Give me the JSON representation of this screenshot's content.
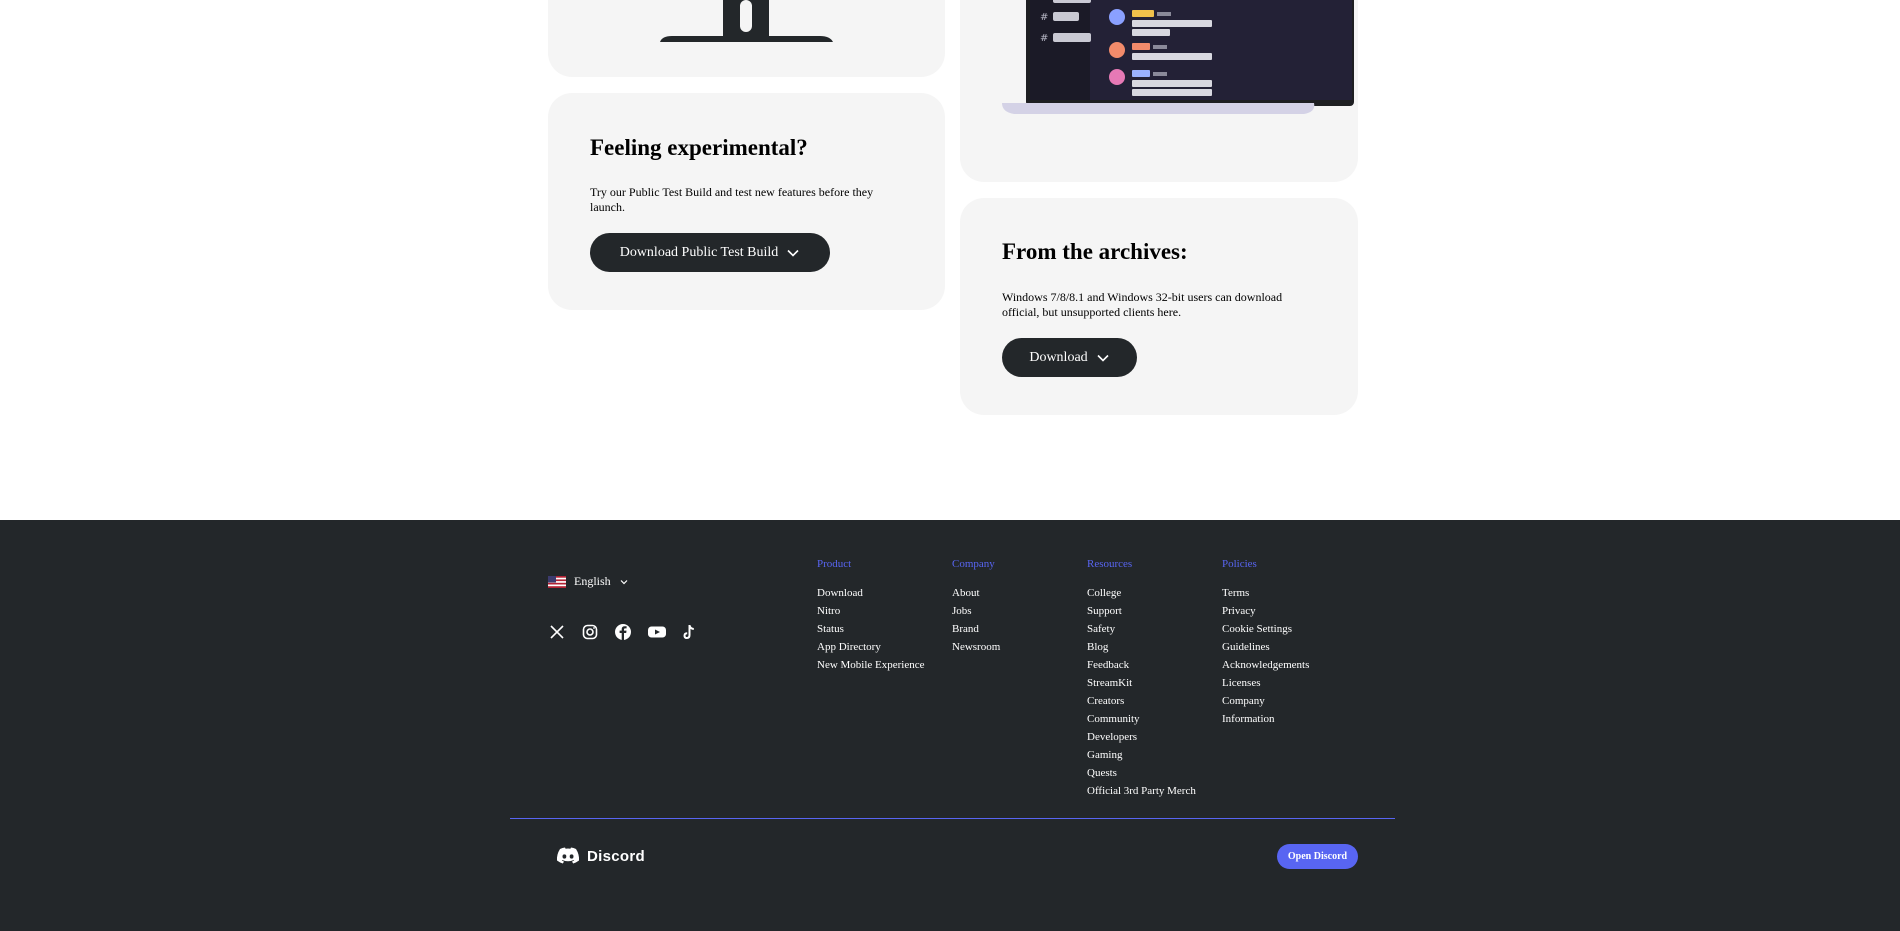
{
  "cards": {
    "experimental": {
      "title": "Feeling experimental?",
      "body": "Try our Public Test Build and test new features before they launch.",
      "button": "Download Public Test Build"
    },
    "archives": {
      "title": "From the archives:",
      "body": "Windows 7/8/8.1 and Windows 32-bit users can download official, but unsupported clients here.",
      "button": "Download"
    }
  },
  "footer": {
    "language": "English",
    "socials": [
      "x-icon",
      "instagram-icon",
      "facebook-icon",
      "youtube-icon",
      "tiktok-icon"
    ],
    "columns": [
      {
        "heading": "Product",
        "links": [
          "Download",
          "Nitro",
          "Status",
          "App Directory",
          "New Mobile Experience"
        ]
      },
      {
        "heading": "Company",
        "links": [
          "About",
          "Jobs",
          "Brand",
          "Newsroom"
        ]
      },
      {
        "heading": "Resources",
        "links": [
          "College",
          "Support",
          "Safety",
          "Blog",
          "Feedback",
          "StreamKit",
          "Creators",
          "Community",
          "Developers",
          "Gaming",
          "Quests",
          "Official 3rd Party Merch"
        ]
      },
      {
        "heading": "Policies",
        "links": [
          "Terms",
          "Privacy",
          "Cookie Settings",
          "Guidelines",
          "Acknowledgements",
          "Licenses",
          "Company",
          "Information"
        ]
      }
    ],
    "brand": "Discord",
    "open_button": "Open Discord"
  },
  "colors": {
    "footer_bg": "#23272a",
    "accent": "#5865f2",
    "card_bg": "#f5f5f5"
  }
}
